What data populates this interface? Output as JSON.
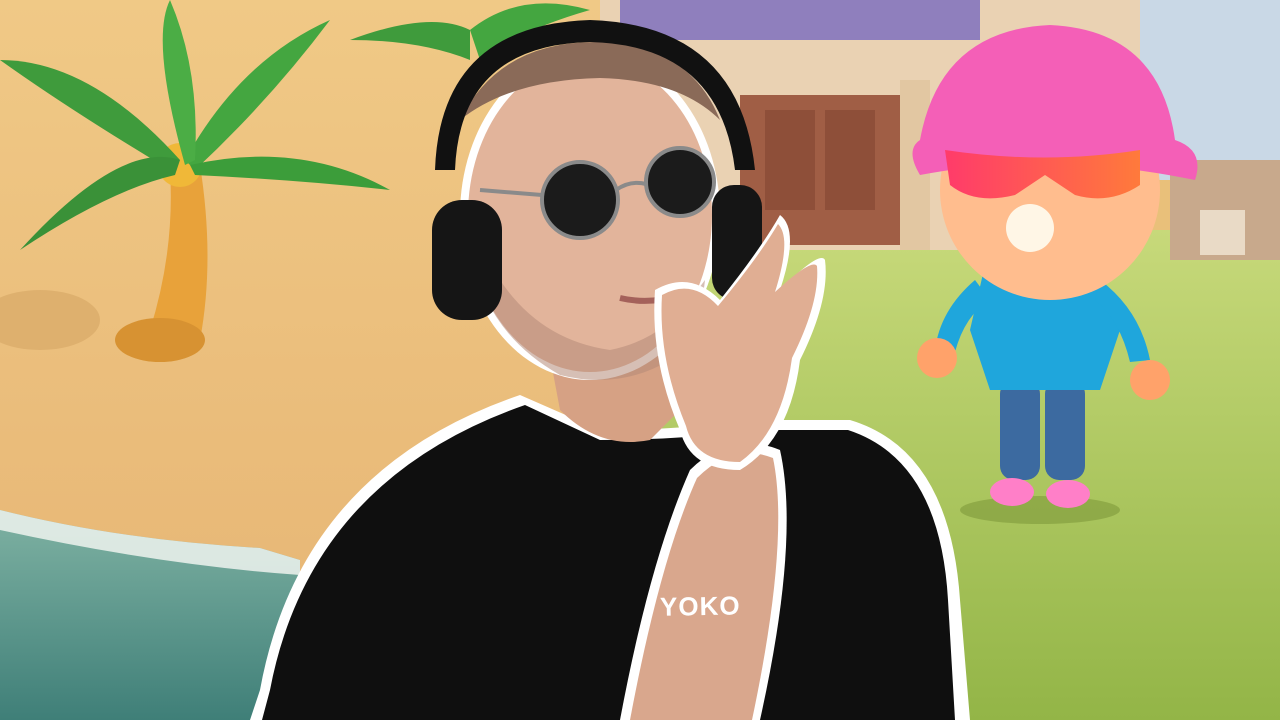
{
  "shirt": {
    "text": "YOKO"
  },
  "colors": {
    "sand": "#EDC483",
    "grass": "#A7C95A",
    "water": "#5E9B8E",
    "shirt": "#0F0F0F",
    "hat": "#F45FB7",
    "hoodie": "#1FA6DC"
  }
}
